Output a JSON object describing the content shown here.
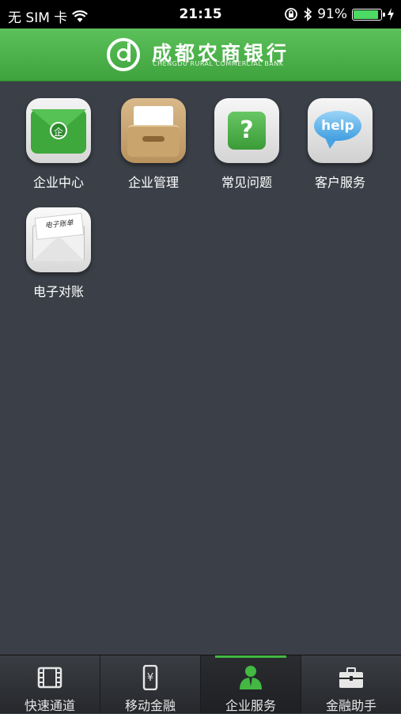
{
  "status_bar": {
    "carrier": "无 SIM 卡",
    "time": "21:15",
    "battery_percent": "91%",
    "battery_level": 0.91
  },
  "header": {
    "bank_name_cn": "成都农商银行",
    "bank_name_en": "CHENGDU RURAL COMMERCIAL BANK"
  },
  "apps": [
    {
      "label": "企业中心",
      "icon": "green-envelope-icon"
    },
    {
      "label": "企业管理",
      "icon": "file-box-icon"
    },
    {
      "label": "常见问题",
      "icon": "question-icon"
    },
    {
      "label": "客户服务",
      "icon": "help-bubble-icon",
      "icon_text": "help"
    },
    {
      "label": "电子对账",
      "icon": "statement-mail-icon",
      "icon_text": "电子账单"
    }
  ],
  "tabs": [
    {
      "label": "快速通道",
      "icon": "film-icon"
    },
    {
      "label": "移动金融",
      "icon": "phone-yuan-icon"
    },
    {
      "label": "企业服务",
      "icon": "person-icon",
      "active": true
    },
    {
      "label": "金融助手",
      "icon": "briefcase-icon"
    }
  ],
  "colors": {
    "header_green": "#4cb34a",
    "background": "#3b4048",
    "active_tab_accent": "#43b843"
  }
}
